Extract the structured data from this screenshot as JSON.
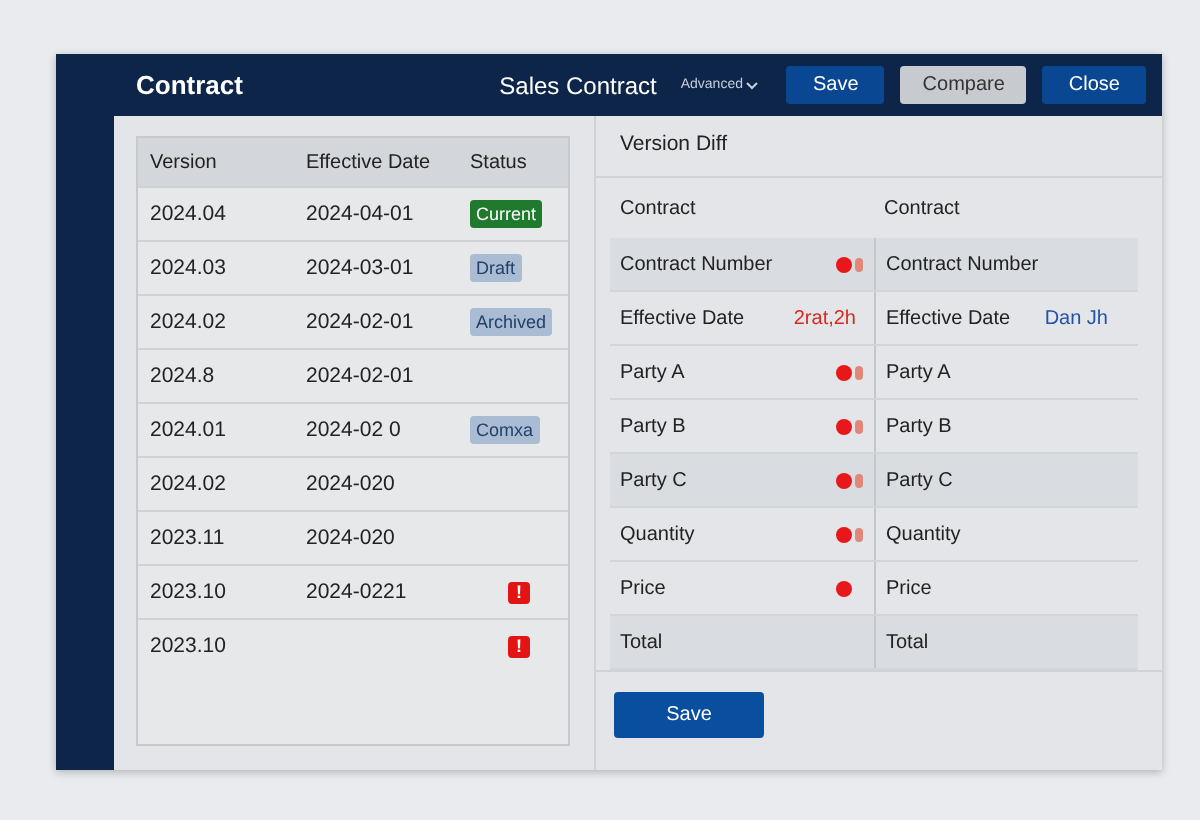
{
  "header": {
    "title": "Contract",
    "document": "Sales Contract",
    "menu": "Advanced",
    "buttons": [
      {
        "label": "Save",
        "kind": "primary"
      },
      {
        "label": "Compare",
        "kind": "secondary"
      },
      {
        "label": "Close",
        "kind": "primary"
      }
    ]
  },
  "versions": {
    "columns": [
      "Version",
      "Effective Date",
      "Status"
    ],
    "rows": [
      {
        "version": "2024.04",
        "date": "2024-04-01",
        "status": {
          "kind": "current",
          "label": "Current"
        }
      },
      {
        "version": "2024.03",
        "date": "2024-03-01",
        "status": {
          "kind": "tag",
          "label": "Draft"
        }
      },
      {
        "version": "2024.02",
        "date": "2024-02-01",
        "status": {
          "kind": "tag",
          "label": "Archived"
        }
      },
      {
        "version": "2024.8",
        "date": "2024-02-01"
      },
      {
        "version": "2024.01",
        "date": "2024-02 0",
        "status": {
          "kind": "tag",
          "label": "Comxa"
        }
      },
      {
        "version": "2024.02",
        "date": "2024-020"
      },
      {
        "version": "2023.11",
        "date": "2024-020"
      },
      {
        "version": "2023.10",
        "date": "2024-0221",
        "status": {
          "kind": "alert",
          "label": "!"
        }
      },
      {
        "version": "2023.10",
        "status": {
          "kind": "alert",
          "label": "!"
        }
      }
    ]
  },
  "diff": {
    "title": "Version Diff",
    "left_heading": "Contract",
    "right_heading": "Contract",
    "rows": [
      {
        "left": "Contract Number",
        "changed": true,
        "conflict": true,
        "right": "Contract Number"
      },
      {
        "left": "Effective Date",
        "left_value": "2rat,2h",
        "changed": false,
        "conflict": false,
        "right": "Effective Date",
        "right_value": "Dan Jh"
      },
      {
        "left": "Party A",
        "changed": true,
        "conflict": true,
        "right": "Party A"
      },
      {
        "left": "Party B",
        "changed": true,
        "conflict": true,
        "right": "Party B"
      },
      {
        "left": "Party C",
        "changed": true,
        "conflict": true,
        "right": "Party C"
      },
      {
        "left": "Quantity",
        "changed": true,
        "conflict": true,
        "right": "Quantity"
      },
      {
        "left": "Price",
        "changed": true,
        "conflict": false,
        "right": "Price"
      },
      {
        "left": "Total",
        "changed": false,
        "conflict": false,
        "right": "Total"
      }
    ],
    "save": "Save"
  }
}
